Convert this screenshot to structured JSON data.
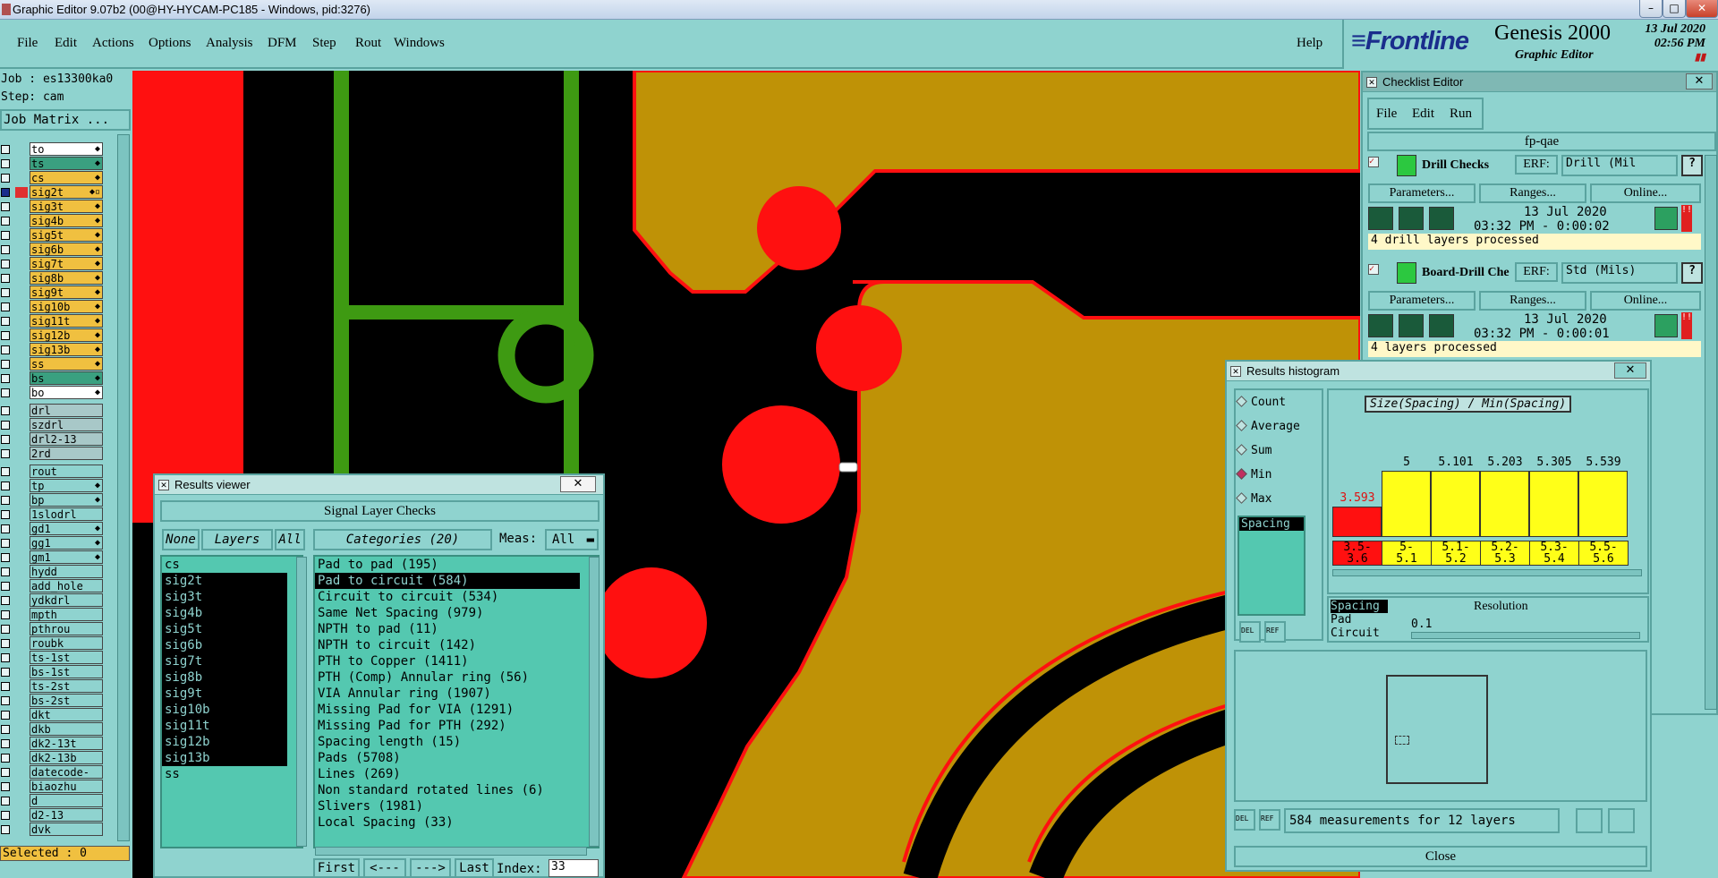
{
  "window": {
    "title": "Graphic Editor 9.07b2 (00@HY-HYCAM-PC185 - Windows, pid:3276)"
  },
  "menu": {
    "items": [
      "File",
      "Edit",
      "Actions",
      "Options",
      "Analysis",
      "DFM",
      "Step",
      "Rout",
      "Windows"
    ],
    "help": "Help"
  },
  "logo": {
    "brand": "Frontline",
    "product": "Genesis 2000",
    "subtitle": "Graphic Editor",
    "date": "13 Jul 2020",
    "time": "02:56 PM"
  },
  "left": {
    "job": "Job : es13300ka0",
    "step": "Step: cam",
    "job_matrix": "Job Matrix ...",
    "selected": "Selected : 0",
    "layers": [
      {
        "name": "to",
        "color": "#ffffff",
        "sw": "",
        "fx": "◆"
      },
      {
        "name": "ts",
        "color": "#3aa080",
        "sw": "",
        "fx": "◆"
      },
      {
        "name": "cs",
        "color": "#f0c040",
        "sw": "",
        "fx": "◆"
      },
      {
        "name": "sig2t",
        "color": "#f0c040",
        "sw": "#e03030",
        "fx": "◆▫",
        "active": true
      },
      {
        "name": "sig3t",
        "color": "#f0c040",
        "sw": "",
        "fx": "◆"
      },
      {
        "name": "sig4b",
        "color": "#f0c040",
        "sw": "",
        "fx": "◆"
      },
      {
        "name": "sig5t",
        "color": "#f0c040",
        "sw": "",
        "fx": "◆"
      },
      {
        "name": "sig6b",
        "color": "#f0c040",
        "sw": "",
        "fx": "◆"
      },
      {
        "name": "sig7t",
        "color": "#f0c040",
        "sw": "",
        "fx": "◆"
      },
      {
        "name": "sig8b",
        "color": "#f0c040",
        "sw": "",
        "fx": "◆"
      },
      {
        "name": "sig9t",
        "color": "#f0c040",
        "sw": "",
        "fx": "◆"
      },
      {
        "name": "sig10b",
        "color": "#f0c040",
        "sw": "",
        "fx": "◆"
      },
      {
        "name": "sig11t",
        "color": "#f0c040",
        "sw": "",
        "fx": "◆"
      },
      {
        "name": "sig12b",
        "color": "#f0c040",
        "sw": "",
        "fx": "◆"
      },
      {
        "name": "sig13b",
        "color": "#f0c040",
        "sw": "",
        "fx": "◆"
      },
      {
        "name": "ss",
        "color": "#f0c040",
        "sw": "",
        "fx": "◆"
      },
      {
        "name": "bs",
        "color": "#3aa080",
        "sw": "",
        "fx": "◆"
      },
      {
        "name": "bo",
        "color": "#ffffff",
        "sw": "",
        "fx": "◆"
      },
      {
        "name": "drl",
        "color": "#a8c8c8",
        "sw": "",
        "fx": ""
      },
      {
        "name": "szdrl",
        "color": "#a8c8c8",
        "sw": "",
        "fx": ""
      },
      {
        "name": "drl2-13",
        "color": "#a8c8c8",
        "sw": "",
        "fx": ""
      },
      {
        "name": "2rd",
        "color": "#a8c8c8",
        "sw": "",
        "fx": ""
      },
      {
        "name": "rout",
        "color": "#8fd3cf",
        "sw": "",
        "fx": ""
      },
      {
        "name": "tp",
        "color": "#8fd3cf",
        "sw": "",
        "fx": "◆"
      },
      {
        "name": "bp",
        "color": "#8fd3cf",
        "sw": "",
        "fx": "◆"
      },
      {
        "name": "1slodrl",
        "color": "#8fd3cf",
        "sw": "",
        "fx": ""
      },
      {
        "name": "gd1",
        "color": "#8fd3cf",
        "sw": "",
        "fx": "◆"
      },
      {
        "name": "gg1",
        "color": "#8fd3cf",
        "sw": "",
        "fx": "◆"
      },
      {
        "name": "gm1",
        "color": "#8fd3cf",
        "sw": "",
        "fx": "◆"
      },
      {
        "name": "hydd",
        "color": "#8fd3cf",
        "sw": "",
        "fx": ""
      },
      {
        "name": "add_hole",
        "color": "#8fd3cf",
        "sw": "",
        "fx": ""
      },
      {
        "name": "ydkdrl",
        "color": "#8fd3cf",
        "sw": "",
        "fx": ""
      },
      {
        "name": "mpth",
        "color": "#8fd3cf",
        "sw": "",
        "fx": ""
      },
      {
        "name": "pthrou",
        "color": "#8fd3cf",
        "sw": "",
        "fx": ""
      },
      {
        "name": "roubk",
        "color": "#8fd3cf",
        "sw": "",
        "fx": ""
      },
      {
        "name": "ts-1st",
        "color": "#8fd3cf",
        "sw": "",
        "fx": ""
      },
      {
        "name": "bs-1st",
        "color": "#8fd3cf",
        "sw": "",
        "fx": ""
      },
      {
        "name": "ts-2st",
        "color": "#8fd3cf",
        "sw": "",
        "fx": ""
      },
      {
        "name": "bs-2st",
        "color": "#8fd3cf",
        "sw": "",
        "fx": ""
      },
      {
        "name": "dkt",
        "color": "#8fd3cf",
        "sw": "",
        "fx": ""
      },
      {
        "name": "dkb",
        "color": "#8fd3cf",
        "sw": "",
        "fx": ""
      },
      {
        "name": "dk2-13t",
        "color": "#8fd3cf",
        "sw": "",
        "fx": ""
      },
      {
        "name": "dk2-13b",
        "color": "#8fd3cf",
        "sw": "",
        "fx": ""
      },
      {
        "name": "datecode-bo",
        "color": "#8fd3cf",
        "sw": "",
        "fx": ""
      },
      {
        "name": "biaozhu",
        "color": "#8fd3cf",
        "sw": "",
        "fx": ""
      },
      {
        "name": "d",
        "color": "#8fd3cf",
        "sw": "",
        "fx": ""
      },
      {
        "name": "d2-13",
        "color": "#8fd3cf",
        "sw": "",
        "fx": ""
      },
      {
        "name": "dvk",
        "color": "#8fd3cf",
        "sw": "",
        "fx": ""
      }
    ]
  },
  "results_viewer": {
    "title": "Results viewer",
    "header": "Signal Layer Checks",
    "none": "None",
    "layers": "Layers",
    "all": "All",
    "categories_label": "Categories (20)",
    "meas_label": "Meas:",
    "meas_value": "All",
    "layer_list": [
      {
        "n": "cs",
        "s": false
      },
      {
        "n": "sig2t",
        "s": true
      },
      {
        "n": "sig3t",
        "s": true
      },
      {
        "n": "sig4b",
        "s": true
      },
      {
        "n": "sig5t",
        "s": true
      },
      {
        "n": "sig6b",
        "s": true
      },
      {
        "n": "sig7t",
        "s": true
      },
      {
        "n": "sig8b",
        "s": true
      },
      {
        "n": "sig9t",
        "s": true
      },
      {
        "n": "sig10b",
        "s": true
      },
      {
        "n": "sig11t",
        "s": true
      },
      {
        "n": "sig12b",
        "s": true
      },
      {
        "n": "sig13b",
        "s": true
      },
      {
        "n": "ss",
        "s": false
      }
    ],
    "categories": [
      {
        "n": "Pad to pad (195)",
        "s": false
      },
      {
        "n": "Pad to circuit (584)",
        "s": true
      },
      {
        "n": "Circuit to circuit (534)",
        "s": false
      },
      {
        "n": "Same Net Spacing (979)",
        "s": false
      },
      {
        "n": "NPTH to pad (11)",
        "s": false
      },
      {
        "n": "NPTH to circuit (142)",
        "s": false
      },
      {
        "n": "PTH to Copper (1411)",
        "s": false
      },
      {
        "n": "PTH (Comp) Annular ring (56)",
        "s": false
      },
      {
        "n": "VIA Annular ring (1907)",
        "s": false
      },
      {
        "n": "Missing Pad for VIA (1291)",
        "s": false
      },
      {
        "n": "Missing Pad for PTH (292)",
        "s": false
      },
      {
        "n": "Spacing length (15)",
        "s": false
      },
      {
        "n": "Pads (5708)",
        "s": false
      },
      {
        "n": "Lines (269)",
        "s": false
      },
      {
        "n": "Non standard rotated lines (6)",
        "s": false
      },
      {
        "n": "Slivers (1981)",
        "s": false
      },
      {
        "n": "Local Spacing (33)",
        "s": false
      }
    ],
    "nav": {
      "first": "First",
      "prev": "<---",
      "next": "--->",
      "last": "Last",
      "index_label": "Index:",
      "index": "33"
    }
  },
  "checklist": {
    "title": "Checklist Editor",
    "menu": [
      "File",
      "Edit",
      "Run"
    ],
    "name": "fp-qae",
    "checks": [
      {
        "name": "Drill Checks",
        "erf_label": "ERF:",
        "erf": "Drill (Mil",
        "params": "Parameters...",
        "ranges": "Ranges...",
        "online": "Online...",
        "date": "13 Jul 2020",
        "time": "03:32 PM - 0:00:02",
        "status": "4 drill layers processed"
      },
      {
        "name": "Board-Drill Che",
        "erf_label": "ERF:",
        "erf": "Std (Mils)",
        "params": "Parameters...",
        "ranges": "Ranges...",
        "online": "Online...",
        "date": "13 Jul 2020",
        "time": "03:32 PM - 0:00:01",
        "status": "4 layers processed"
      }
    ]
  },
  "histogram": {
    "title": "Results histogram",
    "modes": [
      {
        "n": "Count",
        "on": false
      },
      {
        "n": "Average",
        "on": false
      },
      {
        "n": "Sum",
        "on": false
      },
      {
        "n": "Min",
        "on": true
      },
      {
        "n": "Max",
        "on": false
      }
    ],
    "measure_list": [
      "Spacing"
    ],
    "header": "Size(Spacing) / Min(Spacing)",
    "bars": [
      {
        "v": "3.593",
        "range": "3.5-\n3.6",
        "red": true,
        "h": 0.28
      },
      {
        "v": "5",
        "range": "5-\n5.1",
        "red": false,
        "h": 0.62
      },
      {
        "v": "5.101",
        "range": "5.1-\n5.2",
        "red": false,
        "h": 0.62
      },
      {
        "v": "5.203",
        "range": "5.2-\n5.3",
        "red": false,
        "h": 0.62
      },
      {
        "v": "5.305",
        "range": "5.3-\n5.4",
        "red": false,
        "h": 0.62
      },
      {
        "v": "5.539",
        "range": "5.5-\n5.6",
        "red": false,
        "h": 0.62
      }
    ],
    "types": [
      "Spacing",
      "Pad",
      "Circuit"
    ],
    "resolution_label": "Resolution",
    "resolution": "0.1",
    "summary": "584 measurements for 12 layers",
    "close": "Close",
    "del": "DEL",
    "ref": "REF"
  }
}
